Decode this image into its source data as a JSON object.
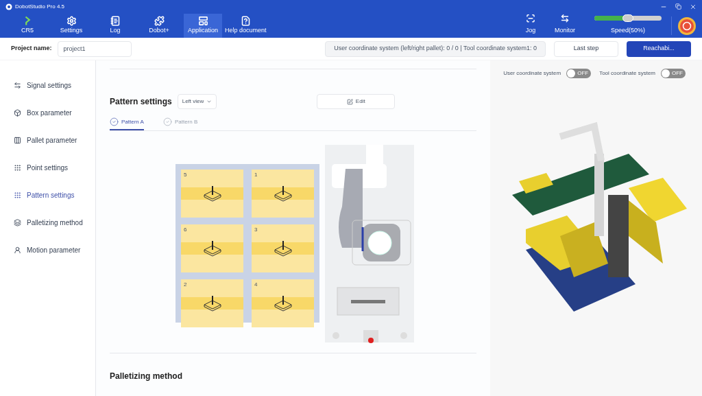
{
  "window": {
    "title": "DobotStudio Pro 4.5"
  },
  "nav": [
    {
      "label": "CR5",
      "selected": false
    },
    {
      "label": "Settings",
      "selected": false
    },
    {
      "label": "Log",
      "selected": false
    },
    {
      "label": "Dobot+",
      "selected": false
    },
    {
      "label": "Application",
      "selected": true
    },
    {
      "label": "Help document",
      "selected": false
    }
  ],
  "nav_right": [
    {
      "label": "Jog"
    },
    {
      "label": "Monitor"
    }
  ],
  "speed": {
    "label": "Speed(50%)",
    "level": 0.5
  },
  "toolbar": {
    "project_label": "Project name:",
    "project_value": "project1",
    "coordinate_info": "User coordinate system (left/right pallet): 0 / 0 | Tool coordinate system1: 0",
    "buttons": [
      {
        "label": "Last step",
        "primary": false
      },
      {
        "label": "Reachabi...",
        "primary": true
      }
    ]
  },
  "sidebar": {
    "items": [
      {
        "label": "Signal settings",
        "selected": false
      },
      {
        "label": "Box parameter",
        "selected": false
      },
      {
        "label": "Pallet parameter",
        "selected": false
      },
      {
        "label": "Point settings",
        "selected": false
      },
      {
        "label": "Pattern settings",
        "selected": true
      },
      {
        "label": "Palletizing method",
        "selected": false
      },
      {
        "label": "Motion parameter",
        "selected": false
      }
    ]
  },
  "pattern": {
    "title": "Pattern settings",
    "view": "Left view",
    "edit": "Edit",
    "tabs": [
      {
        "label": "Pattern A",
        "selected": true
      },
      {
        "label": "Pattern B",
        "selected": false
      }
    ],
    "boxes": [
      "5",
      "1",
      "6",
      "3",
      "2",
      "4"
    ]
  },
  "next_section": "Palletizing method",
  "viewer": {
    "toggles": [
      {
        "label": "User coordinate system",
        "on": false,
        "state": "OFF"
      },
      {
        "label": "Tool coordinate system",
        "on": false,
        "state": "OFF"
      }
    ]
  }
}
